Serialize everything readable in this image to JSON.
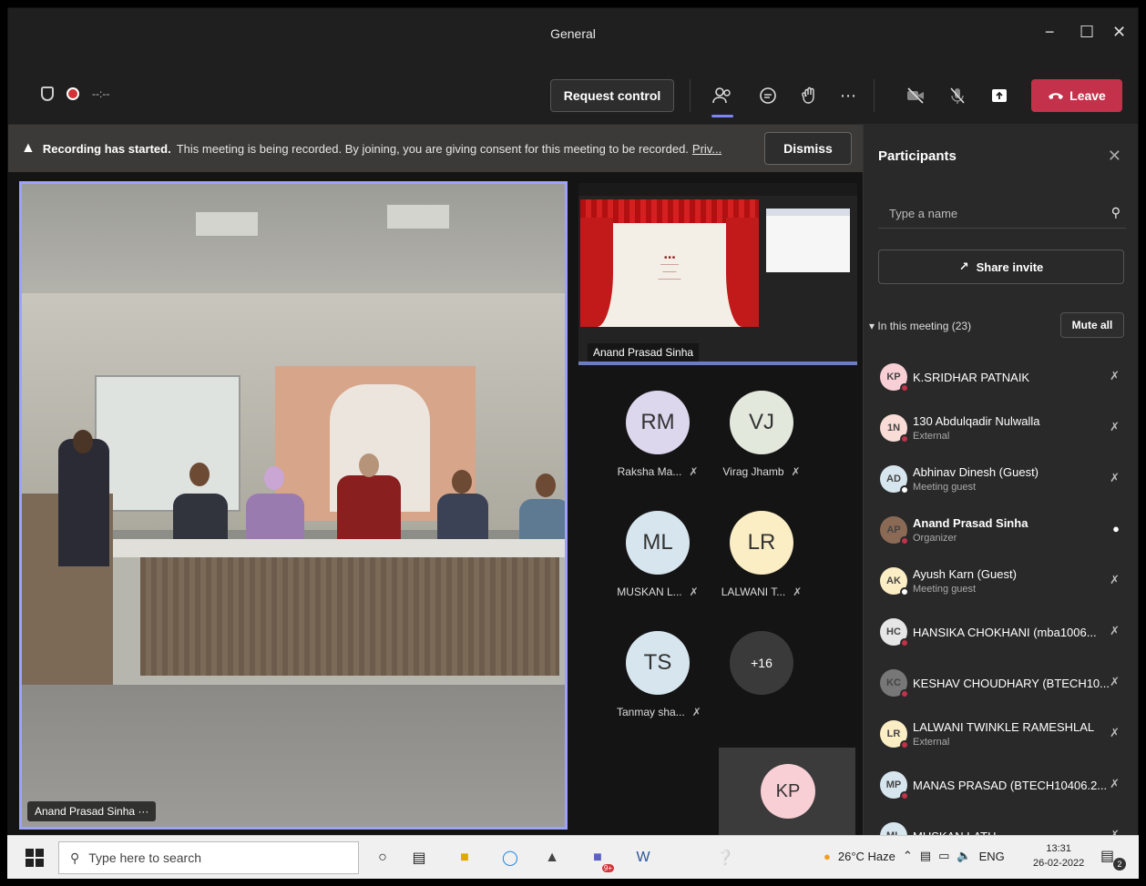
{
  "window": {
    "title": "General",
    "minimize_glyph": "−",
    "maximize_glyph": "☐",
    "close_glyph": "✕"
  },
  "toolbar": {
    "timer": "--:--",
    "request_control_label": "Request control",
    "leave_label": "Leave",
    "icons": [
      "people-icon",
      "chat-icon",
      "react-icon",
      "more-icon",
      "camera-off-icon",
      "mic-off-icon",
      "share-icon"
    ]
  },
  "banner": {
    "bold": "Recording has started.",
    "text": "This meeting is being recorded. By joining, you are giving consent for this meeting to be recorded.",
    "link": "Priv...",
    "dismiss_label": "Dismiss"
  },
  "main_video": {
    "name": "Anand Prasad Sinha",
    "more": "···"
  },
  "share": {
    "presenter": "Anand Prasad Sinha"
  },
  "tiles": [
    {
      "initials": "RM",
      "label": "Raksha Ma...",
      "color": "#ddd7ee"
    },
    {
      "initials": "VJ",
      "label": "Virag Jhamb",
      "color": "#e3e8dd"
    },
    {
      "initials": "ML",
      "label": "MUSKAN L...",
      "color": "#d7e6ee"
    },
    {
      "initials": "LR",
      "label": "LALWANI T...",
      "color": "#fbedc4"
    },
    {
      "initials": "TS",
      "label": "Tanmay sha...",
      "color": "#d7e6ee"
    }
  ],
  "more_tile": "+16",
  "kp_tile": "KP",
  "panel": {
    "title": "Participants",
    "search_placeholder": "Type a name",
    "share_invite_label": "Share invite",
    "in_meeting": "In this meeting (23)",
    "mute_all_label": "Mute all",
    "participants": [
      {
        "initials": "KP",
        "name": "K.SRIDHAR PATNAIK",
        "role": "",
        "color": "#f8cfd5",
        "dot": "#c4314b",
        "bold": false,
        "mic": "off"
      },
      {
        "initials": "1N",
        "name": "130 Abdulqadir Nulwalla",
        "role": "External",
        "color": "#f8dcd5",
        "dot": "#c4314b",
        "bold": false,
        "mic": "off"
      },
      {
        "initials": "AD",
        "name": "Abhinav Dinesh (Guest)",
        "role": "Meeting guest",
        "color": "#d7e6ee",
        "dot": "#ffffff",
        "bold": false,
        "mic": "off"
      },
      {
        "initials": "AP",
        "name": "Anand Prasad Sinha",
        "role": "Organizer",
        "color": "#8a6a55",
        "dot": "#c4314b",
        "bold": true,
        "mic": "on"
      },
      {
        "initials": "AK",
        "name": "Ayush Karn (Guest)",
        "role": "Meeting guest",
        "color": "#fbedc4",
        "dot": "#ffffff",
        "bold": false,
        "mic": "off"
      },
      {
        "initials": "HC",
        "name": "HANSIKA CHOKHANI (mba1006...",
        "role": "",
        "color": "#e6e6e6",
        "dot": "#c4314b",
        "bold": false,
        "mic": "off"
      },
      {
        "initials": "KC",
        "name": "KESHAV CHOUDHARY (BTECH10...",
        "role": "",
        "color": "#777777",
        "dot": "#c4314b",
        "bold": false,
        "mic": "off"
      },
      {
        "initials": "LR",
        "name": "LALWANI TWINKLE RAMESHLAL",
        "role": "External",
        "color": "#fbedc4",
        "dot": "#c4314b",
        "bold": false,
        "mic": "off"
      },
      {
        "initials": "MP",
        "name": "MANAS PRASAD (BTECH10406.2...",
        "role": "",
        "color": "#d7e6ee",
        "dot": "#c4314b",
        "bold": false,
        "mic": "off"
      },
      {
        "initials": "ML",
        "name": "MUSKAN LATH",
        "role": "",
        "color": "#d7e6ee",
        "dot": "#c4314b",
        "bold": false,
        "mic": "off"
      }
    ]
  },
  "taskbar": {
    "search_placeholder": "Type here to search",
    "teams_badge": "9+",
    "weather": "26°C  Haze",
    "lang": "ENG",
    "time": "13:31",
    "date": "26-02-2022",
    "notif_count": "2"
  }
}
